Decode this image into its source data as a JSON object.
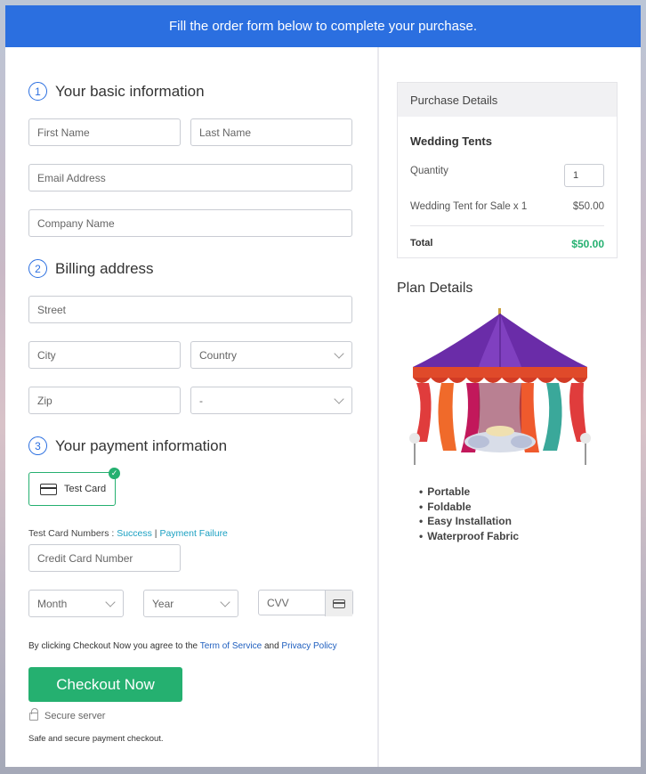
{
  "banner": "Fill the order form below to complete your purchase.",
  "section1": {
    "num": "1",
    "title": "Your basic information"
  },
  "section2": {
    "num": "2",
    "title": "Billing address"
  },
  "section3": {
    "num": "3",
    "title": "Your payment information"
  },
  "basic": {
    "first_name": "First Name",
    "last_name": "Last Name",
    "email": "Email Address",
    "company": "Company Name"
  },
  "billing": {
    "street": "Street",
    "city": "City",
    "country": "Country",
    "zip": "Zip",
    "state": "-"
  },
  "payment": {
    "card_label": "Test Card",
    "test_numbers_label": "Test Card Numbers : ",
    "success_link": "Success",
    "separator": " | ",
    "failure_link": "Payment Failure",
    "card_number": "Credit Card Number",
    "month": "Month",
    "year": "Year",
    "cvv": "CVV"
  },
  "terms": {
    "prefix": "By clicking Checkout Now you agree to the ",
    "terms_link": "Term of Service",
    "and": " and ",
    "privacy_link": "Privacy Policy"
  },
  "checkout_button": "Checkout Now",
  "secure_server": "Secure server",
  "secure_note": "Safe and secure payment checkout.",
  "purchase": {
    "header": "Purchase Details",
    "product": "Wedding Tents",
    "quantity_label": "Quantity",
    "quantity_value": "1",
    "line_item": "Wedding Tent for Sale x 1",
    "line_price": "$50.00",
    "total_label": "Total",
    "total_value": "$50.00"
  },
  "plan": {
    "title": "Plan Details",
    "features": [
      "Portable",
      "Foldable",
      "Easy Installation",
      "Waterproof Fabric"
    ]
  },
  "colors": {
    "accent_blue": "#2b6fe0",
    "accent_green": "#25b070",
    "link": "#1aa0c2"
  }
}
